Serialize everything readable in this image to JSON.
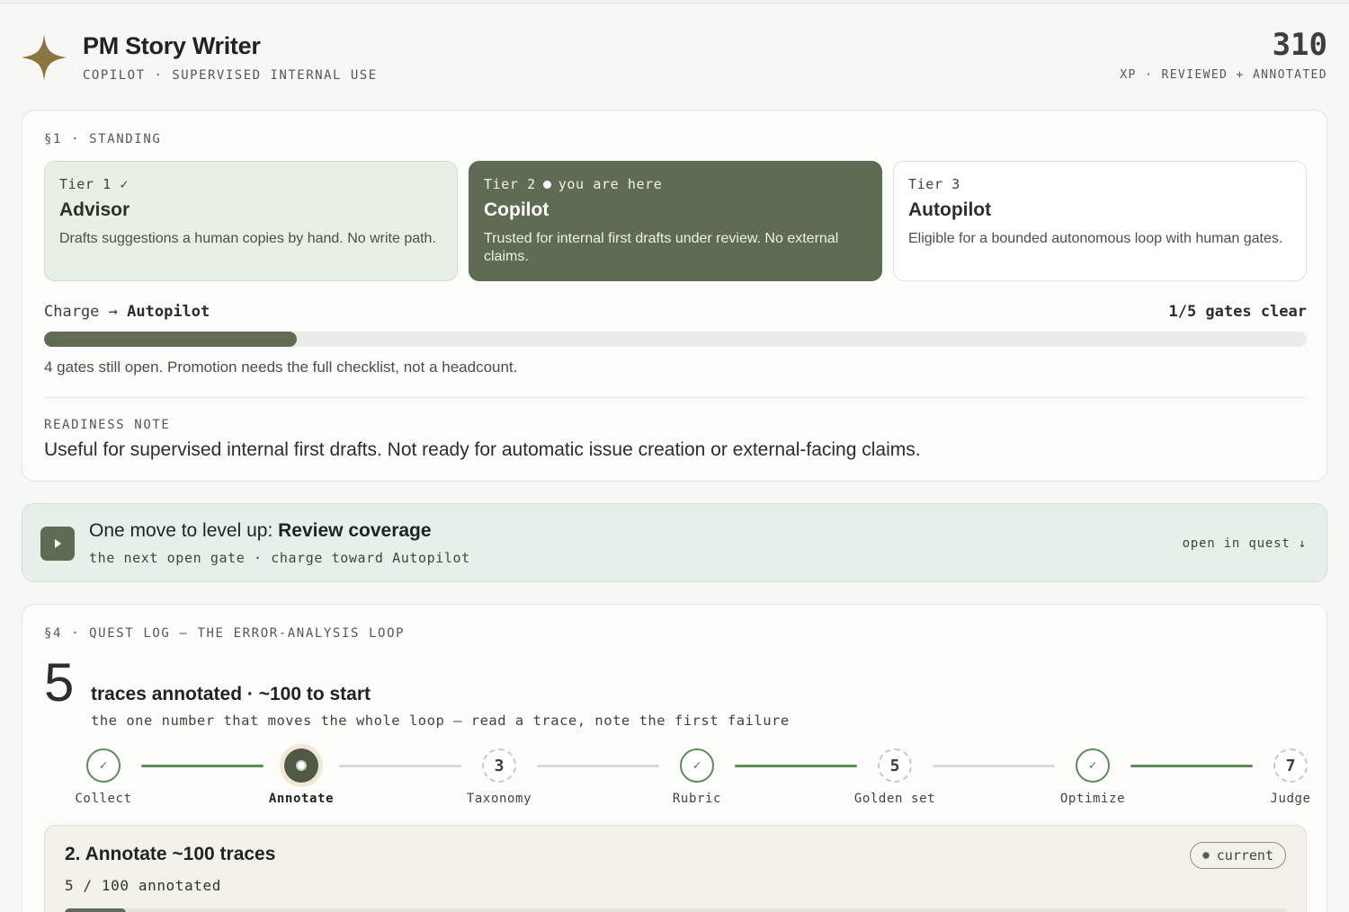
{
  "app": {
    "title": "PM Story Writer",
    "subtitle": "COPILOT · SUPERVISED INTERNAL USE",
    "xp_value": "310",
    "xp_label": "XP · REVIEWED + ANNOTATED",
    "logo_icon": "four-point-star-icon",
    "accent_color": "#5f6b52",
    "logo_color": "#8b7440"
  },
  "standing": {
    "section_label": "§1 · STANDING",
    "tiers": [
      {
        "head": "Tier 1 ✓",
        "name": "Advisor",
        "desc": "Drafts suggestions a human copies by hand. No write path.",
        "state": "done"
      },
      {
        "head": "Tier 2",
        "here": "you are here",
        "name": "Copilot",
        "desc": "Trusted for internal first drafts under review. No external claims.",
        "state": "active"
      },
      {
        "head": "Tier 3",
        "name": "Autopilot",
        "desc": "Eligible for a bounded autonomous loop with human gates.",
        "state": "locked"
      }
    ],
    "charge_prefix": "Charge →",
    "charge_target": "Autopilot",
    "gates_clear": "1/5 gates clear",
    "gates_fraction": 0.2,
    "gates_note": "4 gates still open. Promotion needs the full checklist, not a headcount.",
    "readiness_label": "READINESS NOTE",
    "readiness_text": "Useful for supervised internal first drafts. Not ready for automatic issue creation or external-facing claims."
  },
  "levelup": {
    "prefix": "One move to level up: ",
    "target": "Review coverage",
    "subtitle": "the next open gate · charge toward Autopilot",
    "link": "open in quest ↓",
    "button_icon": "play-icon"
  },
  "quest": {
    "section_label": "§4 · QUEST LOG — THE ERROR-ANALYSIS LOOP",
    "big_number": "5",
    "title": "traces annotated · ~100 to start",
    "subtitle": "the one number that moves the whole loop — read a trace, note the first failure",
    "steps": [
      {
        "label": "Collect",
        "state": "done",
        "mark": "✓"
      },
      {
        "label": "Annotate",
        "state": "current",
        "mark": ""
      },
      {
        "label": "Taxonomy",
        "state": "pending",
        "mark": "3"
      },
      {
        "label": "Rubric",
        "state": "done",
        "mark": "✓"
      },
      {
        "label": "Golden set",
        "state": "pending",
        "mark": "5"
      },
      {
        "label": "Optimize",
        "state": "done",
        "mark": "✓"
      },
      {
        "label": "Judge",
        "state": "pending",
        "mark": "7"
      }
    ],
    "connectors": [
      "on",
      "off",
      "off",
      "on",
      "off",
      "on"
    ],
    "panel": {
      "title": "2. Annotate ~100 traces",
      "count": "5 / 100 annotated",
      "badge": "current",
      "progress_fraction": 0.05
    }
  }
}
